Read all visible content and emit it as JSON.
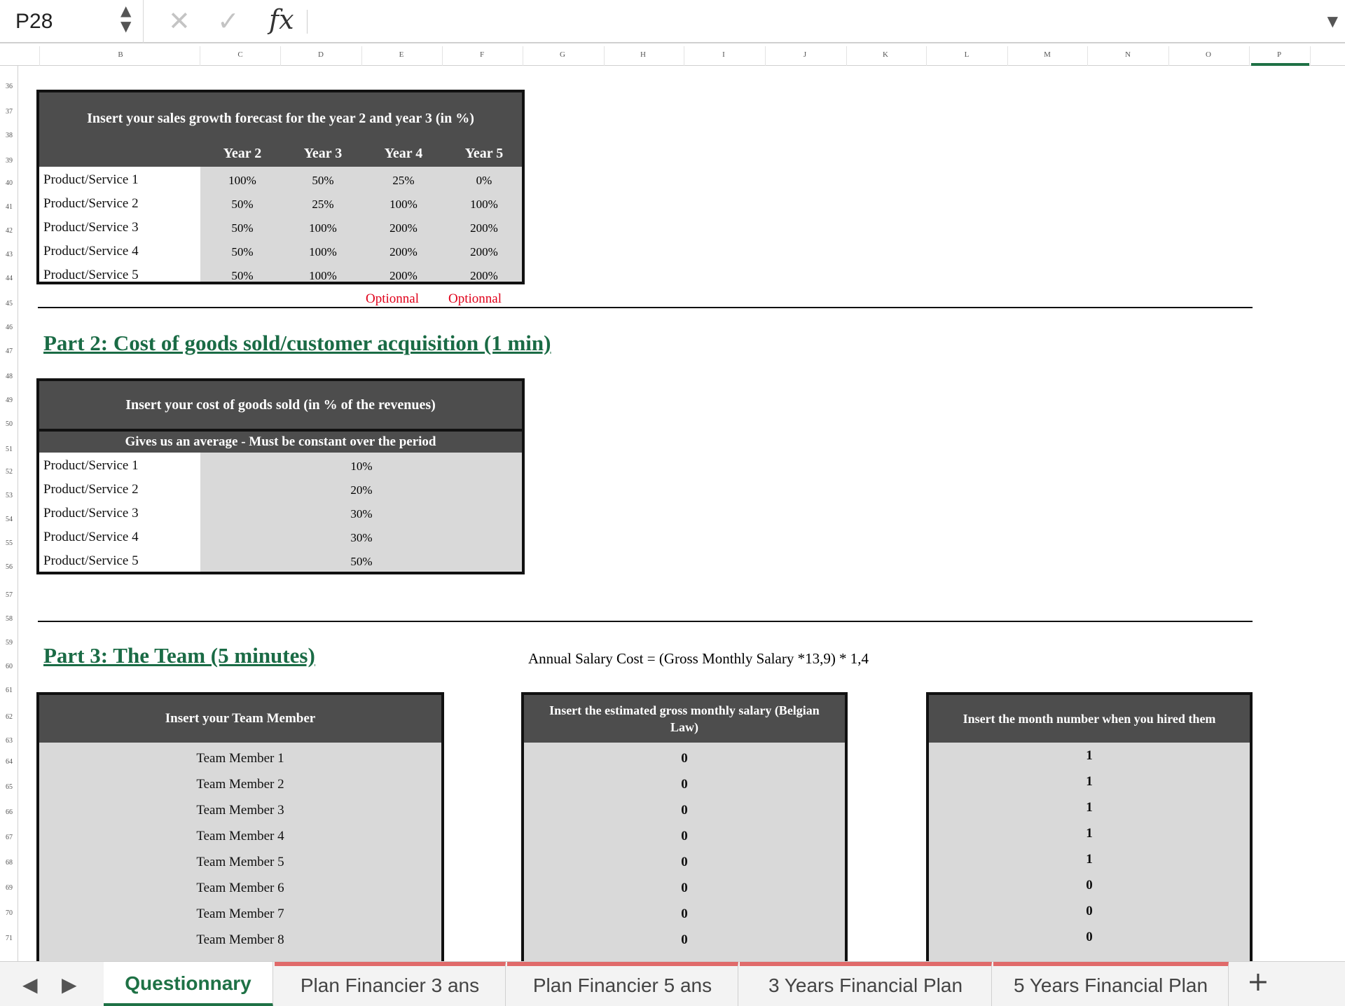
{
  "formula_bar": {
    "cell_ref": "P28",
    "fx_label": "fx"
  },
  "columns": [
    "B",
    "C",
    "D",
    "E",
    "F",
    "G",
    "H",
    "I",
    "J",
    "K",
    "L",
    "M",
    "N",
    "O",
    "P"
  ],
  "rows": [
    "36",
    "37",
    "38",
    "39",
    "40",
    "41",
    "42",
    "43",
    "44",
    "45",
    "46",
    "47",
    "48",
    "49",
    "50",
    "51",
    "52",
    "53",
    "54",
    "55",
    "56",
    "57",
    "58",
    "59",
    "60",
    "61",
    "62",
    "63",
    "64",
    "65",
    "66",
    "67",
    "68",
    "69",
    "70",
    "71"
  ],
  "part1": {
    "title": "Insert your sales growth forecast for the year 2 and year 3 (in %)",
    "year_headers": [
      "Year 2",
      "Year 3",
      "Year 4",
      "Year 5"
    ],
    "rows": [
      {
        "label": "Product/Service 1",
        "values": [
          "100%",
          "50%",
          "25%",
          "0%"
        ]
      },
      {
        "label": "Product/Service 2",
        "values": [
          "50%",
          "25%",
          "100%",
          "100%"
        ]
      },
      {
        "label": "Product/Service 3",
        "values": [
          "50%",
          "100%",
          "200%",
          "200%"
        ]
      },
      {
        "label": "Product/Service 4",
        "values": [
          "50%",
          "100%",
          "200%",
          "200%"
        ]
      },
      {
        "label": "Product/Service 5",
        "values": [
          "50%",
          "100%",
          "200%",
          "200%"
        ]
      }
    ],
    "optional_labels": [
      "Optionnal",
      "Optionnal"
    ]
  },
  "part2": {
    "heading": "Part 2: Cost of goods sold/customer acquisition (1 min)",
    "title": "Insert your cost of goods sold  (in % of the revenues)",
    "subtitle": "Gives us an average - Must be constant over the period",
    "rows": [
      {
        "label": "Product/Service 1",
        "value": "10%"
      },
      {
        "label": "Product/Service 2",
        "value": "20%"
      },
      {
        "label": "Product/Service 3",
        "value": "30%"
      },
      {
        "label": "Product/Service 4",
        "value": "30%"
      },
      {
        "label": "Product/Service 5",
        "value": "50%"
      }
    ]
  },
  "part3": {
    "heading": "Part 3: The Team (5 minutes)",
    "formula_note": "Annual Salary Cost = (Gross Monthly Salary *13,9) * 1,4",
    "team_header": "Insert your Team Member",
    "salary_header": "Insert  the estimated gross monthly salary (Belgian Law)",
    "month_header": "Insert the month number when you hired them",
    "members": [
      "Team Member 1",
      "Team Member 2",
      "Team Member 3",
      "Team Member 4",
      "Team Member 5",
      "Team Member 6",
      "Team Member 7",
      "Team Member 8"
    ],
    "salaries": [
      "0",
      "0",
      "0",
      "0",
      "0",
      "0",
      "0",
      "0"
    ],
    "months": [
      "1",
      "1",
      "1",
      "1",
      "1",
      "0",
      "0",
      "0"
    ]
  },
  "tabs": {
    "active": "Questionnary",
    "others": [
      "Plan Financier 3 ans",
      "Plan Financier 5 ans",
      "3 Years Financial Plan",
      "5 Years Financial Plan"
    ],
    "add_label": "+"
  },
  "colors": {
    "header_fill": "#4d4d4d",
    "input_fill": "#d9d9d9",
    "heading_green": "#1a6b45",
    "optional_red": "#e0001a",
    "tab_accent": "#e06a6a"
  }
}
